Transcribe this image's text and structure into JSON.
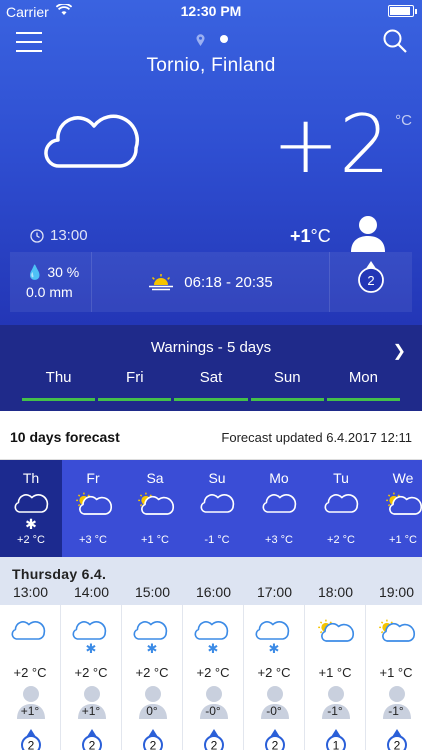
{
  "status_bar": {
    "carrier": "Carrier",
    "time": "12:30 PM",
    "battery_level": 0.9
  },
  "location": {
    "city": "Tornio, Finland"
  },
  "current": {
    "temperature": "+2",
    "unit": "°C",
    "observation_time": "13:00",
    "feels_like": "+1",
    "feels_like_unit": "°C",
    "precip_probability": "30 %",
    "precip_amount": "0.0 mm",
    "sun_times": "06:18 - 20:35",
    "wind_speed": "2"
  },
  "warnings": {
    "title": "Warnings - 5 days",
    "days": [
      "Thu",
      "Fri",
      "Sat",
      "Sun",
      "Mon"
    ]
  },
  "forecast": {
    "title": "10 days forecast",
    "updated": "Forecast updated 6.4.2017 12:11",
    "days": [
      {
        "name": "Th",
        "temp": "+2 °C",
        "icon": "cloud-icon",
        "snow": true
      },
      {
        "name": "Fr",
        "temp": "+3 °C",
        "icon": "partly-cloudy-icon",
        "snow": false
      },
      {
        "name": "Sa",
        "temp": "+1 °C",
        "icon": "partly-cloudy-icon",
        "snow": false
      },
      {
        "name": "Su",
        "temp": "-1 °C",
        "icon": "cloud-icon",
        "snow": false
      },
      {
        "name": "Mo",
        "temp": "+3 °C",
        "icon": "cloud-icon",
        "snow": false
      },
      {
        "name": "Tu",
        "temp": "+2 °C",
        "icon": "cloud-icon",
        "snow": false
      },
      {
        "name": "We",
        "temp": "+1 °C",
        "icon": "partly-cloudy-icon",
        "snow": false
      }
    ]
  },
  "hourly": {
    "date": "Thursday 6.4.",
    "hours": [
      {
        "time": "13:00",
        "icon": "cloud-icon",
        "snow": false,
        "temp": "+2 °C",
        "feels": "+1°",
        "wind": "2"
      },
      {
        "time": "14:00",
        "icon": "cloud-icon",
        "snow": true,
        "temp": "+2 °C",
        "feels": "+1°",
        "wind": "2"
      },
      {
        "time": "15:00",
        "icon": "cloud-icon",
        "snow": true,
        "temp": "+2 °C",
        "feels": "0°",
        "wind": "2"
      },
      {
        "time": "16:00",
        "icon": "cloud-icon",
        "snow": true,
        "temp": "+2 °C",
        "feels": "-0°",
        "wind": "2"
      },
      {
        "time": "17:00",
        "icon": "cloud-icon",
        "snow": true,
        "temp": "+2 °C",
        "feels": "-0°",
        "wind": "2"
      },
      {
        "time": "18:00",
        "icon": "partly-cloudy-icon",
        "snow": false,
        "temp": "+1 °C",
        "feels": "-1°",
        "wind": "1"
      },
      {
        "time": "19:00",
        "icon": "partly-cloudy-icon",
        "snow": false,
        "temp": "+1 °C",
        "feels": "-1°",
        "wind": "2"
      }
    ]
  },
  "colors": {
    "accent": "#3a4dd6",
    "warning_ok": "#44c04a",
    "selected_day": "#1c2a8f"
  }
}
